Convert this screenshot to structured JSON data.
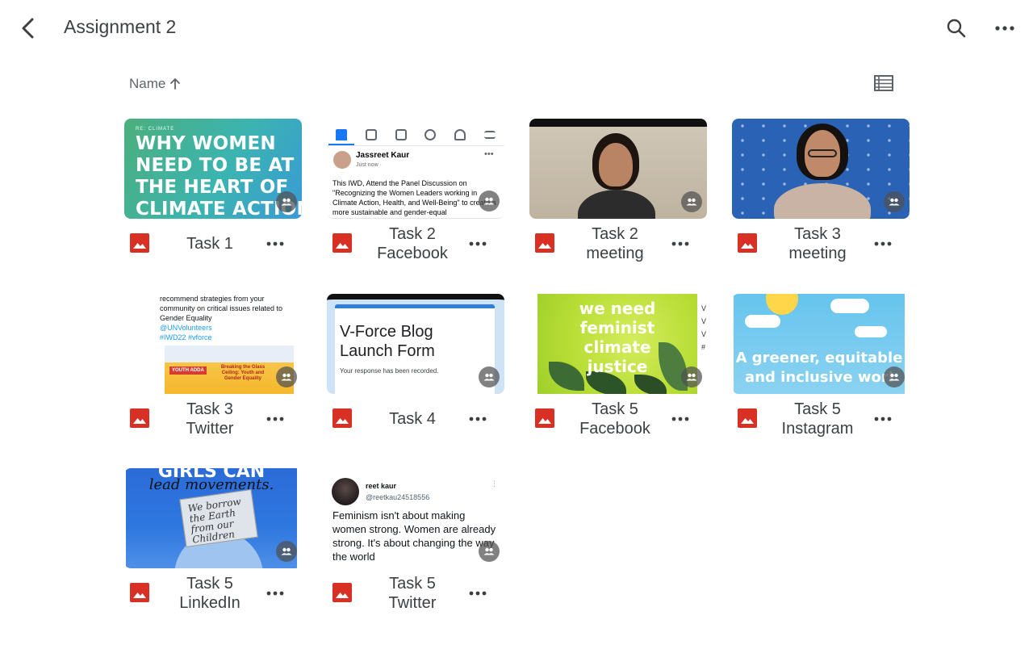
{
  "header": {
    "title": "Assignment 2",
    "back_icon": "chevron-left-icon",
    "search_icon": "search-icon",
    "more_icon": "more-horizontal-icon"
  },
  "sort": {
    "label": "Name",
    "direction_icon": "arrow-up-icon",
    "view_toggle_icon": "list-view-icon"
  },
  "colors": {
    "file_icon_red": "#d93025",
    "text_primary": "#3c4043",
    "facebook_blue": "#1877f2",
    "twitter_blue": "#1d9bf0"
  },
  "files": [
    {
      "label_line1": "Task 1",
      "label_line2": "",
      "icon": "image-file-icon",
      "shared_icon": "people-icon",
      "thumb": {
        "small_text": "RE: CLIMATE",
        "lines": [
          "WHY WOMEN",
          "NEED TO BE AT",
          "THE HEART OF",
          "CLIMATE ACTION"
        ]
      }
    },
    {
      "label_line1": "Task 2",
      "label_line2": "Facebook",
      "icon": "image-file-icon",
      "shared_icon": "people-icon",
      "thumb": {
        "name": "Jassreet Kaur",
        "time": "Just now ·",
        "text": "This IWD, Attend the Panel Discussion on \"Recognizing the Women Leaders working in Climate Action, Health, and Well-Being\" to create a more sustainable and gender-equal"
      }
    },
    {
      "label_line1": "Task 2",
      "label_line2": "meeting",
      "icon": "image-file-icon",
      "shared_icon": "people-icon"
    },
    {
      "label_line1": "Task 3",
      "label_line2": "meeting",
      "icon": "image-file-icon",
      "shared_icon": "people-icon"
    },
    {
      "label_line1": "Task 3",
      "label_line2": "Twitter",
      "icon": "image-file-icon",
      "shared_icon": "people-icon",
      "thumb": {
        "line1": "recommend strategies from your",
        "line2": "community on critical issues related to",
        "line3": "Gender Equality",
        "link1": "@UNVolunteers",
        "link2": "#IWD22 #vforce",
        "badge": "YOUTH ADDA",
        "headline": "Breaking the Glass Ceiling: Youth and Gender Equality"
      }
    },
    {
      "label_line1": "Task 4",
      "label_line2": "",
      "icon": "image-file-icon",
      "shared_icon": "people-icon",
      "thumb": {
        "title_line1": "V-Force Blog",
        "title_line2": "Launch Form",
        "sub": "Your response has been recorded."
      }
    },
    {
      "label_line1": "Task 5",
      "label_line2": "Facebook",
      "icon": "image-file-icon",
      "shared_icon": "people-icon",
      "thumb": {
        "lines": [
          "we need",
          "feminist",
          "climate",
          "justice"
        ]
      }
    },
    {
      "label_line1": "Task 5",
      "label_line2": "Instagram",
      "icon": "image-file-icon",
      "shared_icon": "people-icon",
      "thumb": {
        "line1": "A greener, equitable",
        "line2": "and inclusive worl"
      }
    },
    {
      "label_line1": "Task 5",
      "label_line2": "LinkedIn",
      "icon": "image-file-icon",
      "shared_icon": "people-icon",
      "thumb": {
        "top": "GIRLS CAN",
        "sub": "lead movements.",
        "sign": "We borrow the Earth from our Children"
      }
    },
    {
      "label_line1": "Task 5",
      "label_line2": "Twitter",
      "icon": "image-file-icon",
      "shared_icon": "people-icon",
      "thumb": {
        "name": "reet kaur",
        "handle": "@reetkau24518556",
        "text": "Feminism isn't about making women strong. Women are already strong. It's about changing the way the world"
      }
    }
  ]
}
